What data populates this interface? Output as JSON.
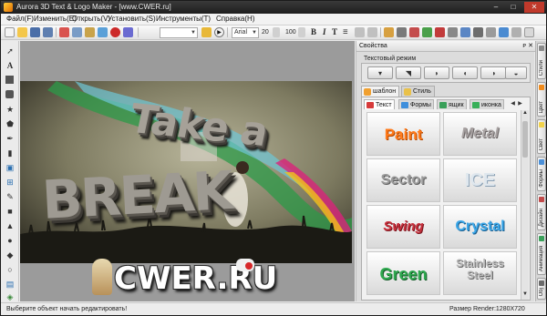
{
  "window": {
    "title": "Aurora 3D Text & Logo Maker - [www.CWER.ru]",
    "buttons": {
      "minimize": "–",
      "maximize": "□",
      "close": "✕"
    }
  },
  "menu": {
    "items": [
      "Файл(F)",
      "Изменить(E)",
      "Открыть(V)",
      "Установить(S)",
      "Инструменты(T)",
      "Справка(H)"
    ]
  },
  "toolbar": {
    "font_value": "Arial",
    "size_value": "20",
    "zoom_value": "100",
    "bold": "B",
    "italic": "I",
    "style_t": "T",
    "justify": "≡"
  },
  "canvas": {
    "headline_top": "Take a",
    "headline_bottom": "BREAK"
  },
  "watermark": {
    "text": "CWER.RU"
  },
  "properties": {
    "title": "Свойства",
    "pin": "ᴘ",
    "close": "✕",
    "text_mode_label": "Текстовый режим",
    "outer_tabs": [
      "шаблон",
      "Стиль"
    ],
    "inner_tabs": [
      "Текст",
      "Формы",
      "ящик",
      "иконка"
    ],
    "tiles": [
      {
        "label": "Paint",
        "color": "#ff7a1a"
      },
      {
        "label": "Metal",
        "color": "#a9a3a3"
      },
      {
        "label": "Sector",
        "color": "#9b9b9b"
      },
      {
        "label": "ICE",
        "color": "#cfd9e3"
      },
      {
        "label": "Swing",
        "color": "#c8303c"
      },
      {
        "label": "Crystal",
        "color": "#3aa6e8"
      },
      {
        "label": "Green",
        "color": "#2fa84f"
      },
      {
        "label": "Stainless Steel",
        "color": "#b7b7b7"
      }
    ]
  },
  "right_tabs": [
    "Стили",
    "Цвет",
    "Свет",
    "Формы",
    "Дизайн",
    "Анимация",
    "Obj"
  ],
  "status": {
    "left": "Выберите объект начать редактировать!",
    "right": "Размер Render:1280X720"
  },
  "colors": {
    "accent": "#e87a00",
    "titlebar": "#1e1e1e"
  }
}
